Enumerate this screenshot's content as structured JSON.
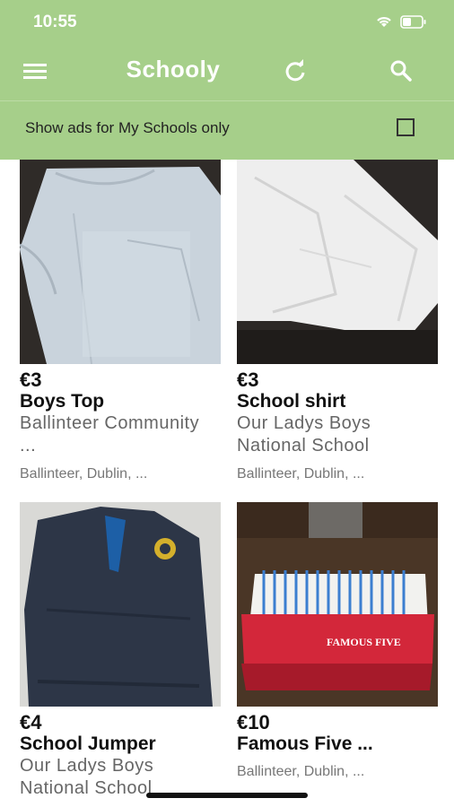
{
  "status_bar": {
    "time": "10:55"
  },
  "appbar": {
    "title": "Schooly"
  },
  "filter": {
    "label": "Show ads for My Schools only",
    "checked": false
  },
  "listings": [
    {
      "price": "€3",
      "name": "Boys Top",
      "school": "Ballinteer Community ...",
      "location": "Ballinteer, Dublin, ..."
    },
    {
      "price": "€3",
      "name": "School shirt",
      "school": "Our Ladys Boys National School",
      "location": "Ballinteer, Dublin, ..."
    },
    {
      "price": "€4",
      "name": "School Jumper",
      "school": "Our Ladys Boys National School",
      "location": ""
    },
    {
      "price": "€10",
      "name": "Famous Five ...",
      "school": "",
      "location": "Ballinteer, Dublin, ...",
      "image_text": "FAMOUS FIVE"
    }
  ],
  "colors": {
    "accent": "#a6cf8a",
    "header_text": "#ffffff"
  }
}
